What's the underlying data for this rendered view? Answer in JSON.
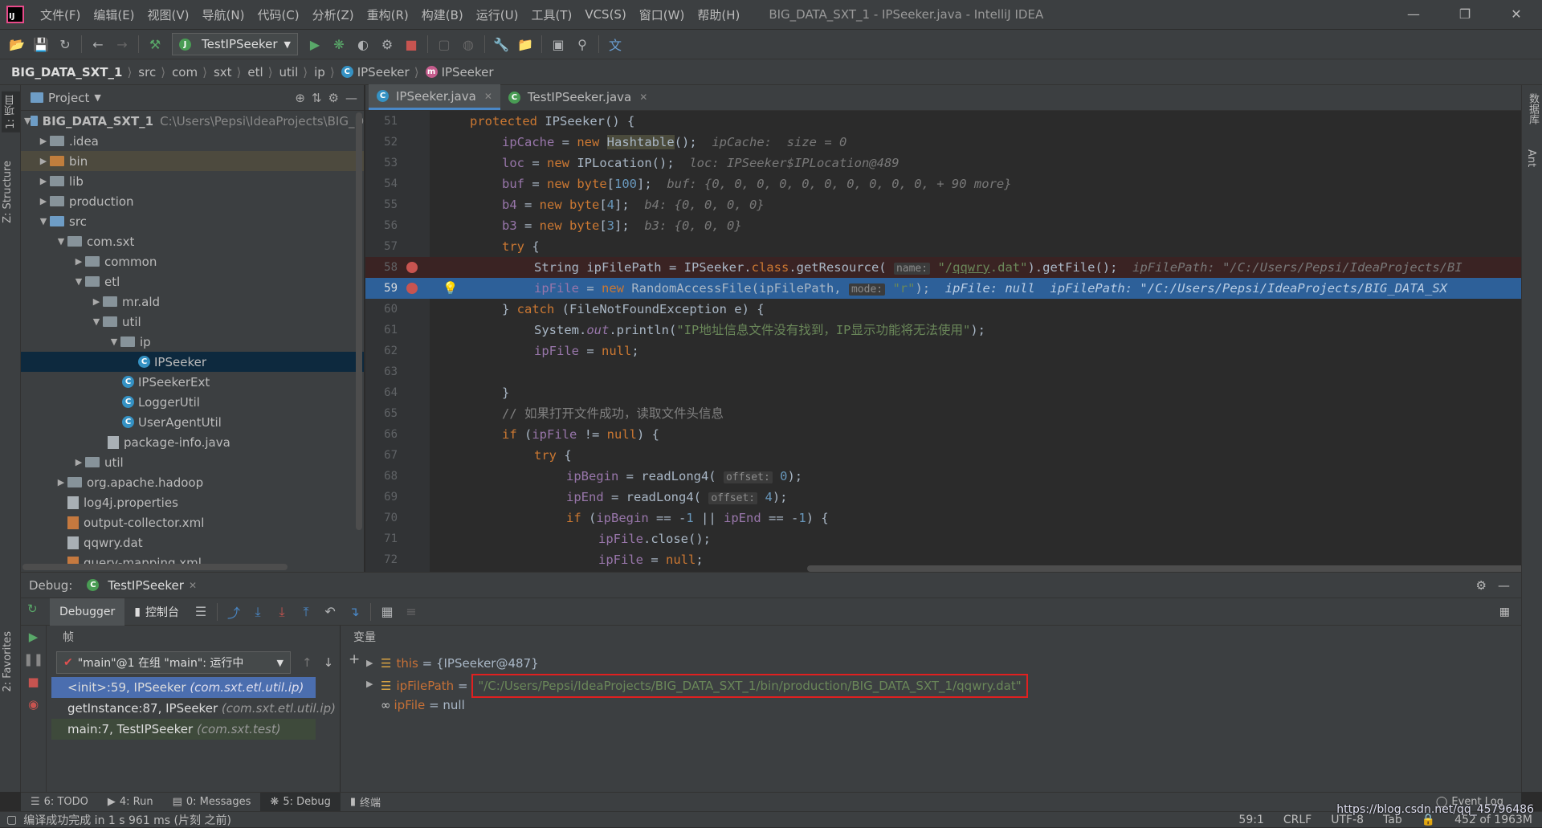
{
  "menu": [
    "文件(F)",
    "编辑(E)",
    "视图(V)",
    "导航(N)",
    "代码(C)",
    "分析(Z)",
    "重构(R)",
    "构建(B)",
    "运行(U)",
    "工具(T)",
    "VCS(S)",
    "窗口(W)",
    "帮助(H)"
  ],
  "window_title": "BIG_DATA_SXT_1 - IPSeeker.java - IntelliJ IDEA",
  "toolbar": {
    "run_config": "TestIPSeeker"
  },
  "breadcrumb": [
    "BIG_DATA_SXT_1",
    "src",
    "com",
    "sxt",
    "etl",
    "util",
    "ip",
    "IPSeeker",
    "IPSeeker"
  ],
  "left_tools": {
    "project": "1: 项目",
    "structure": "Z: Structure",
    "favorites": "2: Favorites"
  },
  "right_tools": {
    "database": "数据库",
    "ant": "Ant"
  },
  "project": {
    "title": "Project",
    "root_name": "BIG_DATA_SXT_1",
    "root_path": "C:\\Users\\Pepsi\\IdeaProjects\\BIG_D",
    "items": [
      ".idea",
      "bin",
      "lib",
      "production",
      "src",
      "com.sxt",
      "common",
      "etl",
      "mr.ald",
      "util",
      "ip",
      "IPSeeker",
      "IPSeekerExt",
      "LoggerUtil",
      "UserAgentUtil",
      "package-info.java",
      "util",
      "org.apache.hadoop",
      "log4j.properties",
      "output-collector.xml",
      "qqwry.dat",
      "query-mapping.xml"
    ]
  },
  "editor": {
    "tabs": [
      "IPSeeker.java",
      "TestIPSeeker.java"
    ],
    "line_numbers": [
      "51",
      "52",
      "53",
      "54",
      "55",
      "56",
      "57",
      "58",
      "59",
      "60",
      "61",
      "62",
      "63",
      "64",
      "65",
      "66",
      "67",
      "68",
      "69",
      "70",
      "71",
      "72"
    ]
  },
  "debug": {
    "label": "Debug:",
    "session": "TestIPSeeker",
    "subtabs": [
      "Debugger",
      "控制台"
    ],
    "frames_header": "帧",
    "vars_header": "变量",
    "thread": "\"main\"@1 在组 \"main\": 运行中",
    "frames": [
      {
        "method": "<init>:59, IPSeeker",
        "pkg": "(com.sxt.etl.util.ip)"
      },
      {
        "method": "getInstance:87, IPSeeker",
        "pkg": "(com.sxt.etl.util.ip)"
      },
      {
        "method": "main:7, TestIPSeeker",
        "pkg": "(com.sxt.test)"
      }
    ],
    "vars": [
      {
        "name": "this",
        "eq": " = ",
        "value": "{IPSeeker@487}"
      },
      {
        "name": "ipFilePath",
        "eq": " = ",
        "value": "\"/C:/Users/Pepsi/IdeaProjects/BIG_DATA_SXT_1/bin/production/BIG_DATA_SXT_1/qqwry.dat\""
      },
      {
        "name": "ipFile",
        "eq": " = ",
        "value": "null"
      }
    ]
  },
  "bottom_tabs": [
    "6: TODO",
    "4: Run",
    "0: Messages",
    "5: Debug",
    "终端"
  ],
  "event_log": "Event Log",
  "status": {
    "message": "编译成功完成 in 1 s 961 ms (片刻 之前)",
    "position": "59:1",
    "line_sep": "CRLF",
    "encoding": "UTF-8",
    "indent": "Tab",
    "memory": "452 of 1963M",
    "watermark": "https://blog.csdn.net/qq_45796486"
  }
}
